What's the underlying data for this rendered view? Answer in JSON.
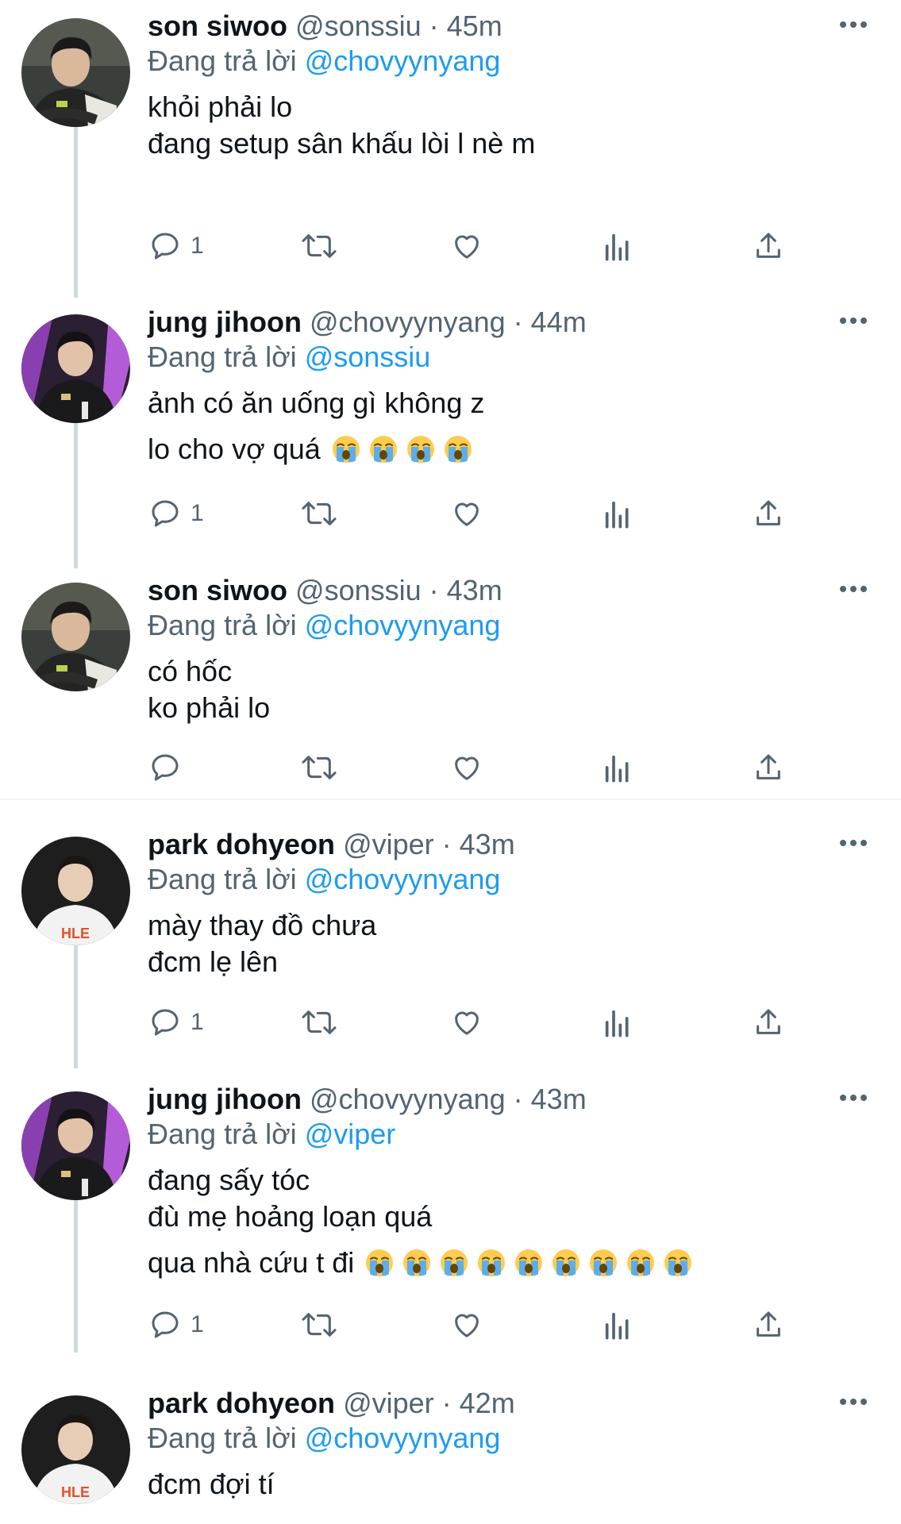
{
  "reply_prefix": "Đang trả lời",
  "colors": {
    "mention": "#1d9bf0",
    "secondary": "#536471",
    "thread_line": "#cfd9de"
  },
  "tweets": [
    {
      "name": "son siwoo",
      "handle": "@sonssiu",
      "time": "· 45m",
      "reply_to": "@chovyynyang",
      "lines": [
        "khỏi phải lo",
        "đang setup sân khấu lòi l nè m"
      ],
      "reply_count": "1",
      "avatar": "avatar-son-siwoo"
    },
    {
      "name": "jung jihoon",
      "handle": "@chovyynyang",
      "time": "· 44m",
      "reply_to": "@sonssiu",
      "lines": [
        "ảnh có ăn uống gì không z",
        "lo cho vợ quá"
      ],
      "emoji": "loudly-crying-face",
      "emoji_count": 4,
      "reply_count": "1",
      "avatar": "avatar-jung-jihoon"
    },
    {
      "name": "son siwoo",
      "handle": "@sonssiu",
      "time": "· 43m",
      "reply_to": "@chovyynyang",
      "lines": [
        "có hốc",
        "ko phải lo"
      ],
      "reply_count": "",
      "avatar": "avatar-son-siwoo"
    },
    {
      "name": "park dohyeon",
      "handle": "@viper",
      "time": "· 43m",
      "reply_to": "@chovyynyang",
      "lines": [
        "mày thay đồ chưa",
        "đcm lẹ lên"
      ],
      "reply_count": "1",
      "avatar": "avatar-park-dohyeon"
    },
    {
      "name": "jung jihoon",
      "handle": "@chovyynyang",
      "time": "· 43m",
      "reply_to": "@viper",
      "lines": [
        "đang sấy tóc",
        "đù mẹ hoảng loạn quá",
        "qua nhà cứu t đi"
      ],
      "emoji": "loudly-crying-face",
      "emoji_count": 9,
      "reply_count": "1",
      "avatar": "avatar-jung-jihoon"
    },
    {
      "name": "park dohyeon",
      "handle": "@viper",
      "time": "· 42m",
      "reply_to": "@chovyynyang",
      "lines": [
        "đcm đợi tí"
      ],
      "reply_count": "",
      "avatar": "avatar-park-dohyeon"
    }
  ]
}
